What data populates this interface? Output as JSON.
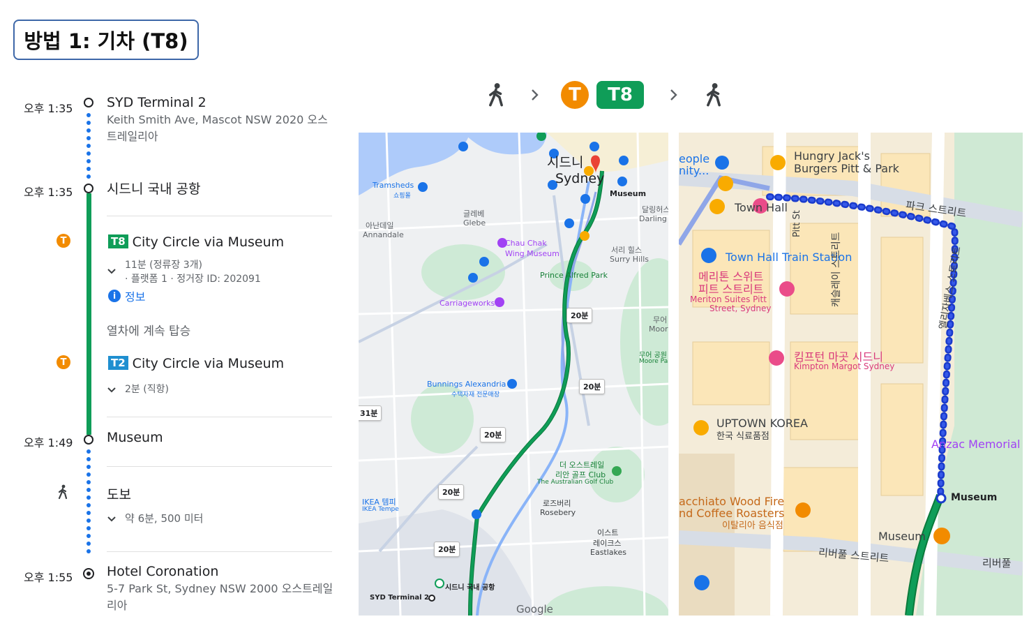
{
  "header": {
    "title": "방법 1: 기차 (T8)"
  },
  "itinerary": {
    "stops": [
      {
        "time": "오후 1:35",
        "name": "SYD Terminal 2",
        "address": "Keith Smith Ave, Mascot NSW 2020 오스트레일리아"
      },
      {
        "time": "오후 1:35",
        "name": "시드니 국내 공항"
      },
      {
        "time": "오후 1:49",
        "name": "Museum"
      },
      {
        "time": "오후 1:55",
        "name": "Hotel Coronation",
        "address": "5-7 Park St, Sydney NSW 2000 오스트레일리아"
      }
    ],
    "leg1": {
      "badge": "T8",
      "badge_color": "#0f9d58",
      "route": "City Circle via Museum",
      "duration": "11분 (정류장 3개)",
      "platform": "· 플랫폼 1 · 정거장 ID: 202091",
      "info": "정보"
    },
    "continue": "열차에 계속 탑승",
    "leg2": {
      "badge": "T2",
      "badge_color": "#1f8fd0",
      "route": "City Circle via Museum",
      "duration": "2분 (직항)"
    },
    "walk": {
      "label": "도보",
      "detail": "약 6분, 500 미터"
    },
    "train_icon_letter": "T"
  },
  "summary_strip": {
    "train_letter": "T",
    "line": "T8"
  },
  "map_left": {
    "labels": {
      "sydney": "시드니",
      "sydney_en": "Sydney",
      "museum": "Museum",
      "tramsheds": "Tramsheds",
      "tramsheds_sub": "쇼핑몰",
      "glebe_ko": "글레베",
      "glebe": "Glebe",
      "annandale_ko": "아난데일",
      "annandale": "Annandale",
      "darlinghurst_ko": "달링허스",
      "darlinghurst": "Darling",
      "chau_chak": "Chau Chak",
      "wing_museum": "Wing Museum",
      "surry_ko": "서리 힐스",
      "surry": "Surry Hills",
      "prince_alfred": "Prince Alfred Park",
      "carriageworks": "Carriageworks",
      "moore_ko": "무어",
      "moore": "Moor",
      "moore_park_ko": "무어 공원",
      "moore_park": "Moore Par",
      "bunnings": "Bunnings Alexandria",
      "bunnings_sub": "수택자재 전문매장",
      "australian_golf_ko": "더 오스트레일",
      "australian_golf_ko2": "리안 골프 Club",
      "australian_golf": "The Australian Golf Club",
      "rosebery_ko": "로즈버리",
      "rosebery": "Rosebery",
      "eastlakes_ko": "이스트",
      "eastlakes_ko2": "레이크스",
      "eastlakes": "Eastlakes",
      "ikea_ko": "IKEA 템피",
      "ikea": "IKEA Tempe",
      "domestic_airport": "시드니 국내 공항",
      "syd_t2": "SYD Terminal 2",
      "google": "Google"
    },
    "bubbles": [
      "20분",
      "20분",
      "20분",
      "20분",
      "20분",
      "31분"
    ]
  },
  "map_right": {
    "labels": {
      "people": "eople",
      "unity": "nity...",
      "hungry1": "Hungry Jack's",
      "hungry2": "Burgers Pitt & Park",
      "town_hall": "Town Hall",
      "park_st": "파크 스트리트",
      "town_hall_station": "Town Hall Train Station",
      "meriton1": "메리톤 스위트",
      "meriton2": "피트 스트리트",
      "meriton3": "Meriton Suites Pitt",
      "meriton4": "Street, Sydney",
      "kimpton1": "킴프턴 마곳 시드니",
      "kimpton2": "Kimpton Margot Sydney",
      "uptown1": "UPTOWN KOREA",
      "uptown2": "한국 식료품점",
      "anzac": "Anzac Memorial",
      "museum": "Museum",
      "acchiato1": "acchiato Wood Fire",
      "acchiato2": "nd Coffee Roasters",
      "acchiato3": "이탈리아 음식점",
      "museum_station": "Museum",
      "liverpool": "리버풀 스트리트",
      "liverpool2": "리버풀",
      "castlereagh": "캐슬레이 스트리트",
      "elizabeth": "엘리자베스 스트리트",
      "pitt_st": "Pitt St"
    }
  },
  "colors": {
    "transit_green": "#0f9d58",
    "walk_blue": "#1a73e8",
    "train_orange": "#f28b00",
    "title_border": "#3d67a8"
  }
}
